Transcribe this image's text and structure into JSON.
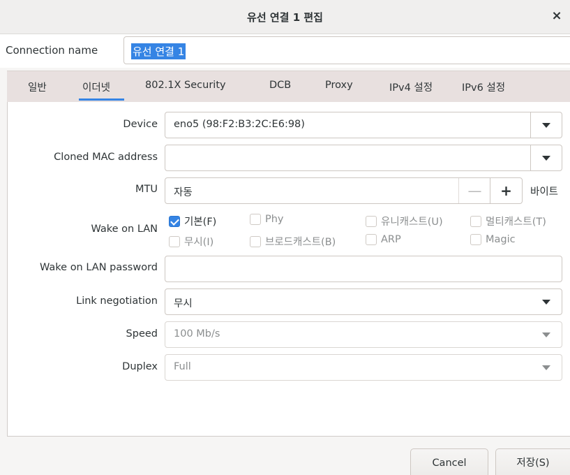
{
  "window": {
    "title": "유선 연결 1 편집",
    "close_glyph": "×"
  },
  "connection": {
    "label": "Connection name",
    "value": "유선 연결 1"
  },
  "tabs": [
    {
      "label": "일반",
      "active": false
    },
    {
      "label": "이더넷",
      "active": true
    },
    {
      "label": "802.1X Security",
      "active": false
    },
    {
      "label": "DCB",
      "active": false
    },
    {
      "label": "Proxy",
      "active": false
    },
    {
      "label": "IPv4 설정",
      "active": false
    },
    {
      "label": "IPv6 설정",
      "active": false
    }
  ],
  "form": {
    "device": {
      "label": "Device",
      "value": "eno5 (98:F2:B3:2C:E6:98)"
    },
    "cloned_mac": {
      "label": "Cloned MAC address",
      "value": ""
    },
    "mtu": {
      "label": "MTU",
      "value": "자동",
      "minus": "—",
      "plus": "+",
      "unit": "바이트"
    },
    "wake_on_lan": {
      "label": "Wake on LAN",
      "options": [
        {
          "label": "기본(F)",
          "checked": true,
          "enabled": true
        },
        {
          "label": "Phy",
          "checked": false,
          "enabled": false
        },
        {
          "label": "유니캐스트(U)",
          "checked": false,
          "enabled": false
        },
        {
          "label": "멀티캐스트(T)",
          "checked": false,
          "enabled": false
        },
        {
          "label": "무시(I)",
          "checked": false,
          "enabled": false
        },
        {
          "label": "브로드캐스트(B)",
          "checked": false,
          "enabled": false
        },
        {
          "label": "ARP",
          "checked": false,
          "enabled": false
        },
        {
          "label": "Magic",
          "checked": false,
          "enabled": false
        }
      ]
    },
    "wol_password": {
      "label": "Wake on LAN password",
      "value": ""
    },
    "link_negotiation": {
      "label": "Link negotiation",
      "value": "무시"
    },
    "speed": {
      "label": "Speed",
      "value": "100 Mb/s"
    },
    "duplex": {
      "label": "Duplex",
      "value": "Full"
    }
  },
  "buttons": {
    "cancel": "Cancel",
    "save": "저장(S)"
  },
  "colors": {
    "accent": "#3584e4",
    "tab_bar": "#e8e0df"
  }
}
